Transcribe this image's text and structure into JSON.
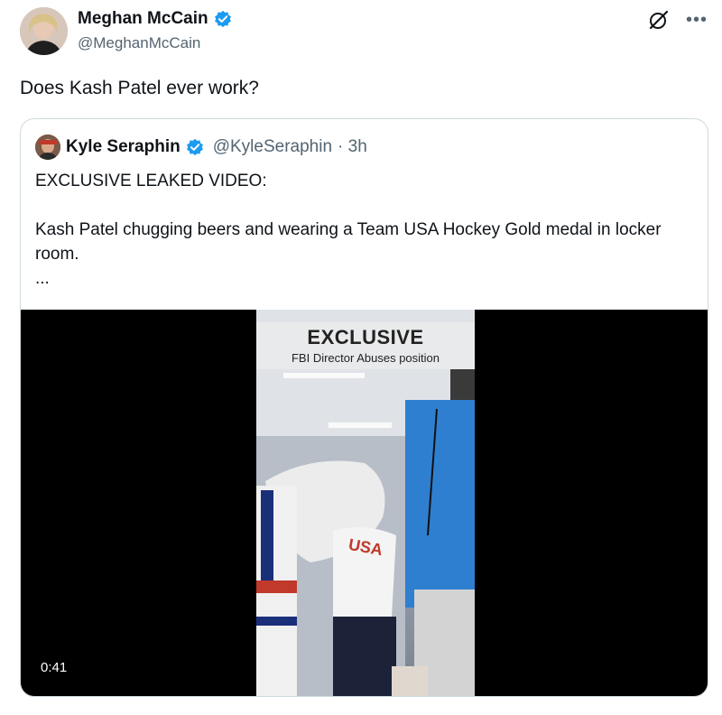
{
  "tweet": {
    "author_name": "Meghan McCain",
    "author_handle": "@MeghanMcCain",
    "text": "Does Kash Patel ever work?"
  },
  "quote": {
    "author_name": "Kyle Seraphin",
    "author_handle": "@KyleSeraphin",
    "time": "· 3h",
    "text": "EXCLUSIVE LEAKED VIDEO:\n\nKash Patel chugging beers and wearing a Team USA Hockey Gold medal in locker room.\n..."
  },
  "video": {
    "banner_title": "EXCLUSIVE",
    "banner_subtitle": "FBI Director Abuses position",
    "jersey_text": "USA",
    "duration": "0:41"
  },
  "colors": {
    "verified": "#1d9bf0",
    "secondary_text": "#536471",
    "border": "#cfd9de"
  },
  "icons": {
    "verified": "verified-badge-icon",
    "grok": "grok-icon",
    "more": "more-options-icon"
  }
}
